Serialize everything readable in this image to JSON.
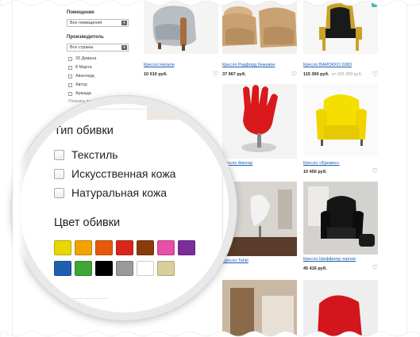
{
  "sidebar": {
    "room_label": "Помещение",
    "room_select": "Все помещения",
    "maker_label": "Производитель",
    "maker_select": "Все страны",
    "makers": [
      "33 Дивана",
      "8 Марта",
      "Авангард",
      "Автор",
      "Армада"
    ],
    "more": "Показать все"
  },
  "products": [
    {
      "title": "Кресло Натали",
      "price": "10 010 руб.",
      "old": ""
    },
    {
      "title": "Кресло Редфорд бежевое",
      "price": "37 967 руб.",
      "old": ""
    },
    {
      "title": "Кресло BAROKKO 6083",
      "price": "115 360 руб.",
      "old": "от 155 360 руб."
    },
    {
      "title": "Кресло «Бремен»",
      "price": "10 450 руб.",
      "old": ""
    },
    {
      "title": "Кресло Шеффилд черное",
      "price": "45 416 руб.",
      "old": ""
    },
    {
      "title": "Кресло Фингер",
      "price": "",
      "old": ""
    },
    {
      "title": "Кресло Tahiti",
      "price": "",
      "old": ""
    }
  ],
  "filter": {
    "upholstery_title": "Тип обивки",
    "upholstery_options": [
      "Текстиль",
      "Искусственная кожа",
      "Натуральная кожа"
    ],
    "color_title": "Цвет обивки",
    "colors_row1": [
      "#e6d800",
      "#f2a300",
      "#e8590c",
      "#d9261c",
      "#8a3b0c",
      "#e84fa5",
      "#7a2e9c"
    ],
    "colors_row2": [
      "#1f5fb0",
      "#3fa535",
      "#000000",
      "#9a9a9a",
      "#ffffff",
      "#d8cf9c"
    ]
  },
  "icons": {
    "favorite": "heart-icon"
  }
}
